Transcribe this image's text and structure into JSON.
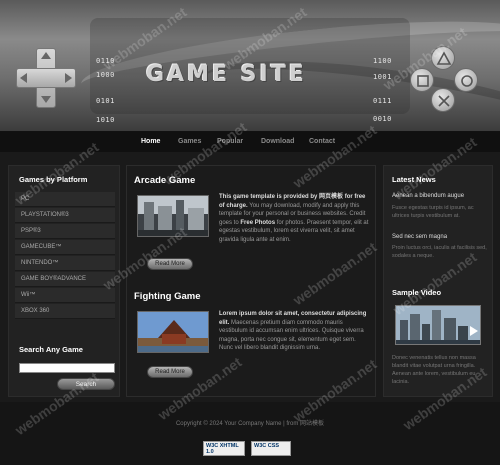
{
  "header": {
    "title": "GAME SITE",
    "binary_left": [
      "0110",
      "1000",
      "0101",
      "1010"
    ],
    "binary_right": [
      "1100",
      "1001",
      "0111",
      "0010"
    ]
  },
  "nav": {
    "items": [
      "Home",
      "Games",
      "Popular",
      "Download",
      "Contact"
    ]
  },
  "sidebar": {
    "platforms_title": "Games by Platform",
    "platforms": [
      "PC",
      "PLAYSTATION®3",
      "PSP®3",
      "GAMECUBE™",
      "NINTENDO™",
      "GAME BOY®ADVANCE",
      "Wii™",
      "XBOX 360"
    ],
    "search_title": "Search Any Game",
    "search_value": "",
    "search_button": "Search"
  },
  "main": {
    "games": [
      {
        "title": "Arcade Game",
        "text_bold": "This game template is provided by 网页模板 for free of charge.",
        "text_rest": " You may download, modify and apply this template for your personal or business websites. Credit goes to ",
        "text_bold2": "Free Photos",
        "text_rest2": " for photos. Praesent tempor, elit at egestas vestibulum, lorem est viverra velit, sit amet gravida ligula ante at enim.",
        "button": "Read More"
      },
      {
        "title": "Fighting Game",
        "text_bold": "Lorem ipsum dolor sit amet, consectetur adipiscing elit.",
        "text_rest": " Maecenas pretium diam commodo mauris vestibulum id accumsan enim ultrices. Quisque viverra magna, porta nec congue sit, elementum eget sem. Nunc vel libero blandit dignissim urna.",
        "text_bold2": "",
        "text_rest2": "",
        "button": "Read More"
      }
    ]
  },
  "right": {
    "news_title": "Latest News",
    "news": [
      {
        "title": "Aenean a bibendum augue",
        "text": "Fusce egestas turpis id ipsum, ac ultrices turpis vestibulum at."
      },
      {
        "title": "Sed nec sem magna",
        "text": "Proin luctus orci, iaculis at facilisis sed, sodales a neque."
      }
    ],
    "video_title": "Sample Video",
    "video_text": "Donec venenatis tellus non massa blandit vitae volutpat urna fringilla. Aenean ante lorem, vestibulum eu lacinia."
  },
  "footer": {
    "copyright": "Copyright © 2024 Your Company Name | from 网站模板",
    "badges": [
      "W3C XHTML 1.0",
      "W3C CSS"
    ]
  },
  "watermark": "webmoban.net",
  "colors": {
    "background": "#1a1a1a",
    "panel": "#222222",
    "title": "#ffffff",
    "nav_active": "#ffffff"
  }
}
